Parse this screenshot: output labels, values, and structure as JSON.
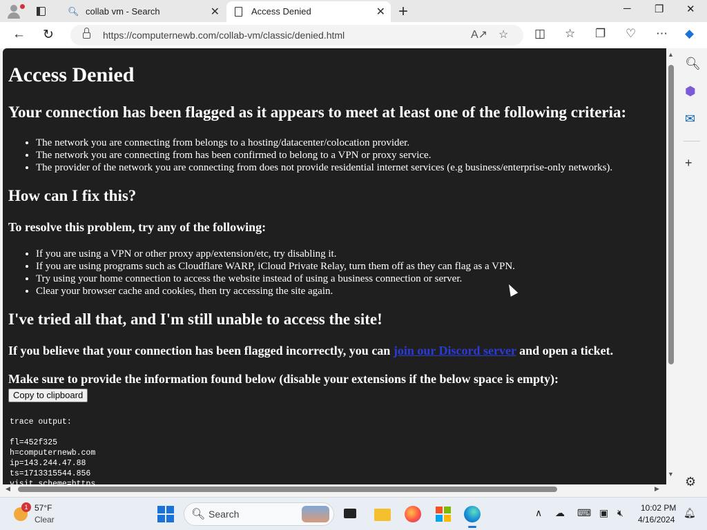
{
  "browser": {
    "tabs": [
      {
        "title": "collab vm - Search"
      },
      {
        "title": "Access Denied"
      }
    ],
    "address": "https://computernewb.com/collab-vm/classic/denied.html"
  },
  "page": {
    "title": "Access Denied",
    "flagged_heading": "Your connection has been flagged as it appears to meet at least one of the following criteria:",
    "criteria": [
      "The network you are connecting from belongs to a hosting/datacenter/colocation provider.",
      "The network you are connecting from has been confirmed to belong to a VPN or proxy service.",
      "The provider of the network you are connecting from does not provide residential internet services (e.g business/enterprise-only networks)."
    ],
    "fix_heading": "How can I fix this?",
    "resolve_heading": "To resolve this problem, try any of the following:",
    "fixes": [
      "If you are using a VPN or other proxy app/extension/etc, try disabling it.",
      "If you are using programs such as Cloudflare WARP, iCloud Private Relay, turn them off as they can flag as a VPN.",
      "Try using your home connection to access the website instead of using a business connection or server.",
      "Clear your browser cache and cookies, then try accessing the site again."
    ],
    "still_heading": "I've tried all that, and I'm still unable to access the site!",
    "incorrect_before": "If you believe that your connection has been flagged incorrectly, you can ",
    "discord_link": "join our Discord server",
    "incorrect_after": " and open a ticket.",
    "provide_heading": "Make sure to provide the information found below (disable your extensions if the below space is empty):",
    "copy_button": "Copy to clipboard",
    "trace": "trace output:\n\nfl=452f325\nh=computernewb.com\nip=143.244.47.88\nts=1713315544.856\nvisit_scheme=https"
  },
  "taskbar": {
    "weather_badge": "1",
    "temperature": "57°F",
    "condition": "Clear",
    "search_label": "Search",
    "time": "10:02 PM",
    "date": "4/16/2024"
  }
}
